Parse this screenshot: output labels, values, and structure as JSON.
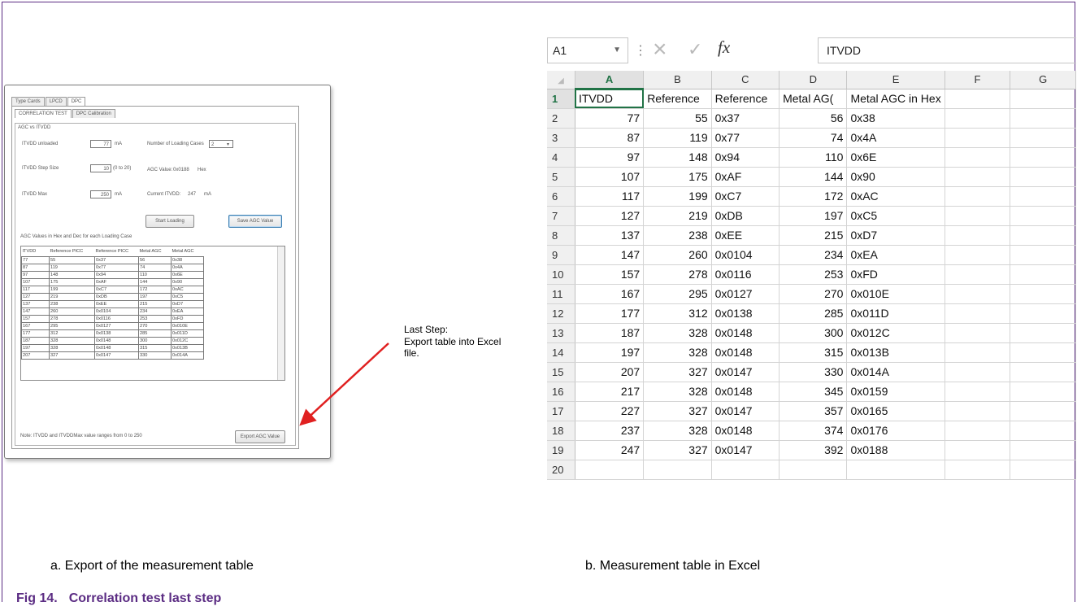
{
  "dialog": {
    "tabs": [
      "Type Cards",
      "LPCD",
      "DPC"
    ],
    "subtabs": [
      "CORRELATION TEST",
      "DPC Calibration"
    ],
    "section_label": "AGC vs ITVDD",
    "itvdd_unloaded_label": "ITVDD unloaded",
    "itvdd_unloaded_value": "77",
    "unit_ma": "mA",
    "loading_cases_label": "Number of Loading Cases",
    "loading_cases_value": "2",
    "step_label": "ITVDD Step Size",
    "step_value": "10",
    "step_range": "(0 to 20)",
    "agc_value_label": "AGC Value:",
    "agc_value": "0x0188",
    "agc_unit": "Hex",
    "itvdd_max_label": "ITVDD Max",
    "itvdd_max_value": "250",
    "current_itvdd_label": "Current ITVDD:",
    "current_itvdd_value": "247",
    "start_loading": "Start Loading",
    "save_agc": "Save AGC Value",
    "table_caption": "AGC Values in Hex and Dec for each Loading Case",
    "table_headers": [
      "ITVDD",
      "Reference PICC",
      "Reference PICC",
      "Metal AGC",
      "Metal AGC"
    ],
    "table_rows": [
      [
        "77",
        "55",
        "0x37",
        "56",
        "0x38"
      ],
      [
        "87",
        "119",
        "0x77",
        "74",
        "0x4A"
      ],
      [
        "97",
        "148",
        "0x94",
        "110",
        "0x6E"
      ],
      [
        "107",
        "175",
        "0xAF",
        "144",
        "0x90"
      ],
      [
        "117",
        "199",
        "0xC7",
        "172",
        "0xAC"
      ],
      [
        "127",
        "219",
        "0xDB",
        "197",
        "0xC5"
      ],
      [
        "137",
        "238",
        "0xEE",
        "215",
        "0xD7"
      ],
      [
        "147",
        "260",
        "0x0104",
        "234",
        "0xEA"
      ],
      [
        "157",
        "278",
        "0x0116",
        "253",
        "0xFD"
      ],
      [
        "167",
        "295",
        "0x0127",
        "270",
        "0x010E"
      ],
      [
        "177",
        "312",
        "0x0138",
        "285",
        "0x011D"
      ],
      [
        "187",
        "328",
        "0x0148",
        "300",
        "0x012C"
      ],
      [
        "197",
        "328",
        "0x0148",
        "315",
        "0x013B"
      ],
      [
        "207",
        "327",
        "0x0147",
        "330",
        "0x014A"
      ]
    ],
    "note": "Note: ITVDD and ITVDDMax value ranges from 0 to 250",
    "export_button": "Export AGC Value"
  },
  "annotation": {
    "line1": "Last  Step:",
    "line2": "Export table into Excel",
    "line3": "file.",
    "arrow_color": "#e02020"
  },
  "excel": {
    "name_box": "A1",
    "formula": "ITVDD",
    "fx": "fx",
    "cancel_icon": "×",
    "enter_icon": "✓",
    "columns": [
      "A",
      "B",
      "C",
      "D",
      "E",
      "F",
      "G"
    ],
    "header_row": [
      "ITVDD",
      "Reference",
      "Reference",
      "Metal AG(",
      "Metal AGC in Hex"
    ],
    "rows": [
      [
        "77",
        "55",
        "0x37",
        "56",
        "0x38"
      ],
      [
        "87",
        "119",
        "0x77",
        "74",
        "0x4A"
      ],
      [
        "97",
        "148",
        "0x94",
        "110",
        "0x6E"
      ],
      [
        "107",
        "175",
        "0xAF",
        "144",
        "0x90"
      ],
      [
        "117",
        "199",
        "0xC7",
        "172",
        "0xAC"
      ],
      [
        "127",
        "219",
        "0xDB",
        "197",
        "0xC5"
      ],
      [
        "137",
        "238",
        "0xEE",
        "215",
        "0xD7"
      ],
      [
        "147",
        "260",
        "0x0104",
        "234",
        "0xEA"
      ],
      [
        "157",
        "278",
        "0x0116",
        "253",
        "0xFD"
      ],
      [
        "167",
        "295",
        "0x0127",
        "270",
        "0x010E"
      ],
      [
        "177",
        "312",
        "0x0138",
        "285",
        "0x011D"
      ],
      [
        "187",
        "328",
        "0x0148",
        "300",
        "0x012C"
      ],
      [
        "197",
        "328",
        "0x0148",
        "315",
        "0x013B"
      ],
      [
        "207",
        "327",
        "0x0147",
        "330",
        "0x014A"
      ],
      [
        "217",
        "328",
        "0x0148",
        "345",
        "0x0159"
      ],
      [
        "227",
        "327",
        "0x0147",
        "357",
        "0x0165"
      ],
      [
        "237",
        "328",
        "0x0148",
        "374",
        "0x0176"
      ],
      [
        "247",
        "327",
        "0x0147",
        "392",
        "0x0188"
      ]
    ],
    "accent": "#217346"
  },
  "captions": {
    "a": "a.   Export of the measurement table",
    "b": "b.   Measurement table in Excel",
    "fig_num": "Fig 14.",
    "fig_title": "Correlation test last step",
    "fig_color": "#5b2c83"
  }
}
